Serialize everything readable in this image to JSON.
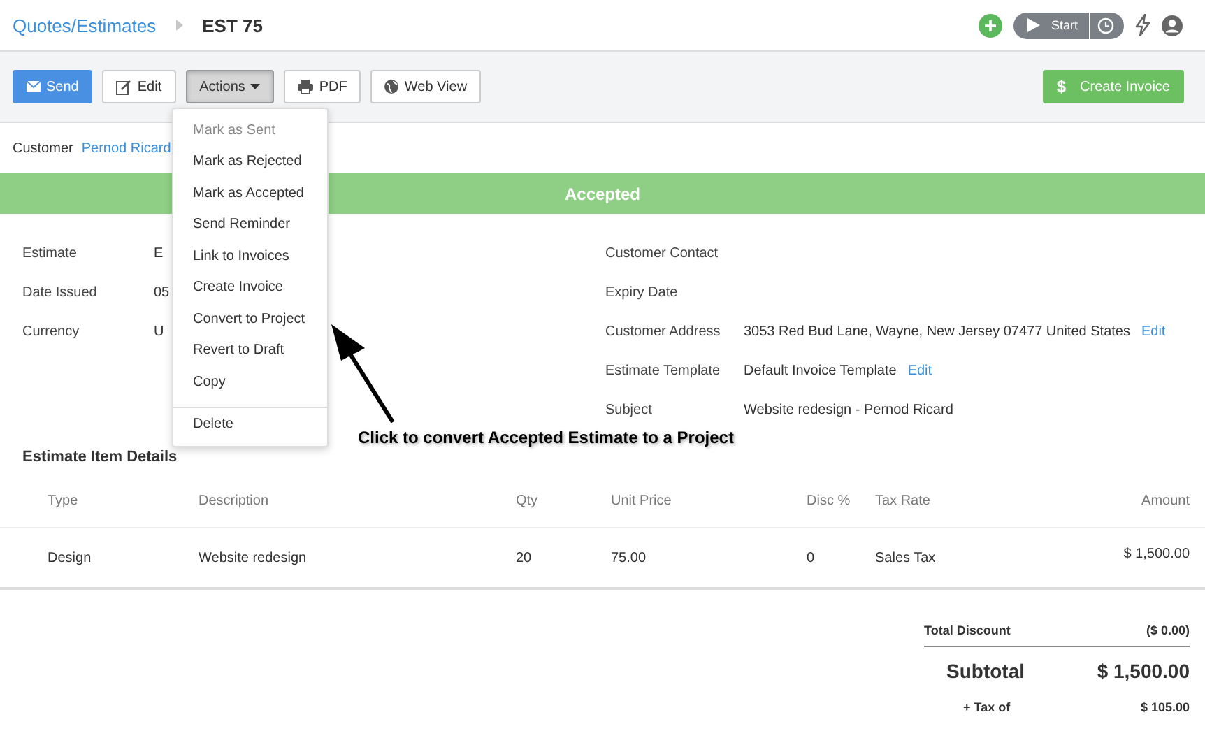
{
  "breadcrumb": {
    "parent": "Quotes/Estimates",
    "current": "EST 75"
  },
  "timer": {
    "label": "Start"
  },
  "toolbar": {
    "buttons": [
      {
        "label": "Send",
        "kind": "primary",
        "pressed": false
      },
      {
        "label": "Edit",
        "kind": "default",
        "pressed": false
      },
      {
        "label": "Actions",
        "kind": "dropdown",
        "pressed": true
      },
      {
        "label": "PDF",
        "kind": "default",
        "pressed": false
      },
      {
        "label": "Web View",
        "kind": "default",
        "pressed": false
      }
    ],
    "create_invoice": {
      "label": "Create Invoice",
      "icon_text": "$"
    }
  },
  "customer": {
    "label": "Customer",
    "value": "Pernod Ricard"
  },
  "status_banner": "Accepted",
  "details_left": [
    {
      "label": "Estimate",
      "value": "E"
    },
    {
      "label": "Date Issued",
      "value": "05"
    },
    {
      "label": "Currency",
      "value": "U"
    }
  ],
  "details_right": [
    {
      "label": "Customer Contact"
    },
    {
      "label": "Expiry Date"
    },
    {
      "label": "Customer Address",
      "value": "3053 Red Bud Lane, Wayne, New Jersey 07477 United States",
      "link": "Edit"
    },
    {
      "label": "Estimate Template",
      "value": "Default Invoice Template",
      "link": "Edit"
    },
    {
      "label": "Subject",
      "value": "Website redesign - Pernod Ricard"
    }
  ],
  "actions_menu": {
    "items": [
      {
        "label": "Mark as Sent",
        "disabled": true
      },
      {
        "label": "Mark as Rejected",
        "disabled": false
      },
      {
        "label": "Mark as Accepted",
        "disabled": false
      },
      {
        "label": "Send Reminder",
        "disabled": false
      },
      {
        "label": "Link to Invoices",
        "disabled": false
      },
      {
        "label": "Create Invoice",
        "disabled": false
      },
      {
        "label": "Convert to Project",
        "disabled": false
      },
      {
        "label": "Revert to Draft",
        "disabled": false
      },
      {
        "label": "Copy",
        "disabled": false
      }
    ],
    "footer_items": [
      {
        "label": "Delete",
        "disabled": false
      }
    ]
  },
  "annotation": "Click to convert Accepted Estimate to a Project",
  "items_section": {
    "title": "Estimate Item Details",
    "columns": [
      "Type",
      "Description",
      "Qty",
      "Unit Price",
      "Disc %",
      "Tax Rate",
      "Amount"
    ],
    "rows": [
      [
        "Design",
        "Website redesign",
        "20",
        "75.00",
        "0",
        "Sales Tax",
        "$ 1,500.00"
      ]
    ]
  },
  "totals": [
    {
      "label": "Total Discount",
      "value": "($ 0.00)",
      "kind": "discount"
    },
    {
      "label": "Subtotal",
      "value": "$ 1,500.00",
      "kind": "subtotal"
    },
    {
      "label": "+ Tax of",
      "value": "$ 105.00",
      "kind": "tax"
    }
  ]
}
